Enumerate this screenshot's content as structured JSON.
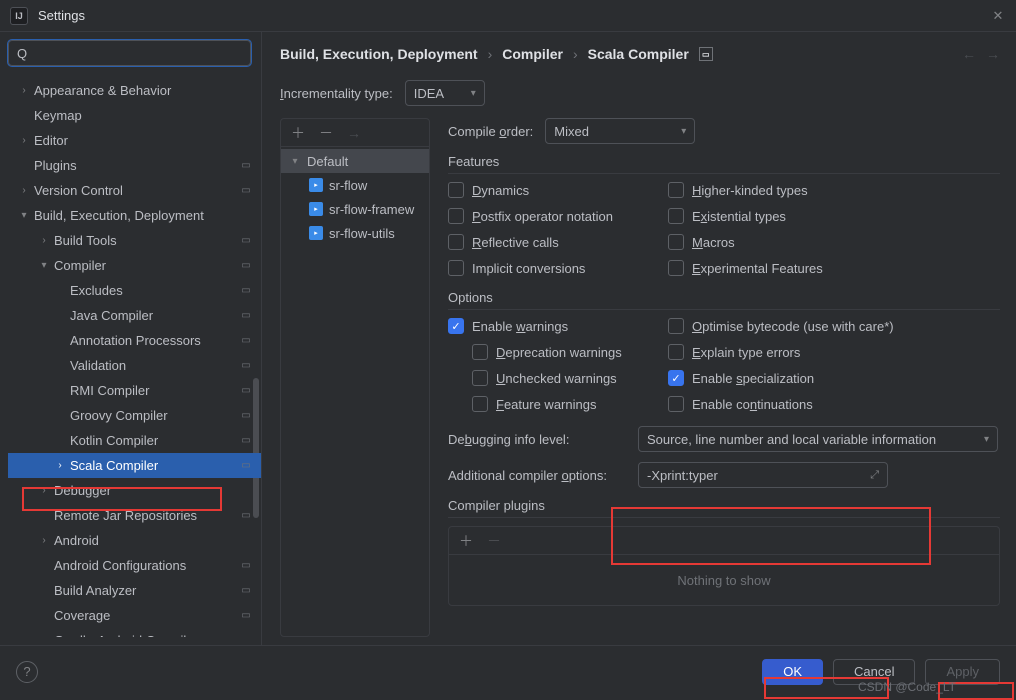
{
  "window": {
    "title": "Settings"
  },
  "search": {
    "placeholder": ""
  },
  "nav": {
    "items": [
      {
        "label": "Appearance & Behavior",
        "chev": ">",
        "indent": 0,
        "cfg": false
      },
      {
        "label": "Keymap",
        "chev": "",
        "indent": 0,
        "cfg": false
      },
      {
        "label": "Editor",
        "chev": ">",
        "indent": 0,
        "cfg": false
      },
      {
        "label": "Plugins",
        "chev": "",
        "indent": 0,
        "cfg": true
      },
      {
        "label": "Version Control",
        "chev": ">",
        "indent": 0,
        "cfg": true
      },
      {
        "label": "Build, Execution, Deployment",
        "chev": "v",
        "indent": 0,
        "cfg": false
      },
      {
        "label": "Build Tools",
        "chev": ">",
        "indent": 1,
        "cfg": true
      },
      {
        "label": "Compiler",
        "chev": "v",
        "indent": 1,
        "cfg": true
      },
      {
        "label": "Excludes",
        "chev": "",
        "indent": 2,
        "cfg": true
      },
      {
        "label": "Java Compiler",
        "chev": "",
        "indent": 2,
        "cfg": true
      },
      {
        "label": "Annotation Processors",
        "chev": "",
        "indent": 2,
        "cfg": true
      },
      {
        "label": "Validation",
        "chev": "",
        "indent": 2,
        "cfg": true
      },
      {
        "label": "RMI Compiler",
        "chev": "",
        "indent": 2,
        "cfg": true
      },
      {
        "label": "Groovy Compiler",
        "chev": "",
        "indent": 2,
        "cfg": true
      },
      {
        "label": "Kotlin Compiler",
        "chev": "",
        "indent": 2,
        "cfg": true
      },
      {
        "label": "Scala Compiler",
        "chev": ">",
        "indent": 2,
        "cfg": true,
        "selected": true
      },
      {
        "label": "Debugger",
        "chev": ">",
        "indent": 1,
        "cfg": false
      },
      {
        "label": "Remote Jar Repositories",
        "chev": "",
        "indent": 1,
        "cfg": true
      },
      {
        "label": "Android",
        "chev": ">",
        "indent": 1,
        "cfg": false
      },
      {
        "label": "Android Configurations",
        "chev": "",
        "indent": 1,
        "cfg": true
      },
      {
        "label": "Build Analyzer",
        "chev": "",
        "indent": 1,
        "cfg": true
      },
      {
        "label": "Coverage",
        "chev": "",
        "indent": 1,
        "cfg": true
      },
      {
        "label": "Gradle-Android Compiler",
        "chev": "",
        "indent": 1,
        "cfg": true
      }
    ]
  },
  "breadcrumb": {
    "a": "Build, Execution, Deployment",
    "b": "Compiler",
    "c": "Scala Compiler"
  },
  "incrementality": {
    "label": "Incrementality type:",
    "value": "IDEA"
  },
  "compileOrder": {
    "label": "Compile order:",
    "value": "Mixed"
  },
  "profiles": {
    "default": "Default",
    "items": [
      "sr-flow",
      "sr-flow-framew",
      "sr-flow-utils"
    ]
  },
  "features": {
    "title": "Features",
    "dynamics": "Dynamics",
    "higher": "Higher-kinded types",
    "postfix": "Postfix operator notation",
    "existential": "Existential types",
    "reflective": "Reflective calls",
    "macros": "Macros",
    "implicit": "Implicit conversions",
    "experimental": "Experimental Features"
  },
  "options": {
    "title": "Options",
    "enableWarnings": "Enable warnings",
    "optimise": "Optimise bytecode (use with care*)",
    "deprecation": "Deprecation warnings",
    "explain": "Explain type errors",
    "unchecked": "Unchecked warnings",
    "specialization": "Enable specialization",
    "feature": "Feature warnings",
    "continuations": "Enable continuations"
  },
  "debugging": {
    "label": "Debugging info level:",
    "value": "Source, line number and local variable information"
  },
  "additional": {
    "label": "Additional compiler options:",
    "value": "-Xprint:typer"
  },
  "plugins": {
    "title": "Compiler plugins",
    "empty": "Nothing to show"
  },
  "footer": {
    "ok": "OK",
    "cancel": "Cancel",
    "apply": "Apply"
  },
  "watermark": "CSDN @Code_LT"
}
